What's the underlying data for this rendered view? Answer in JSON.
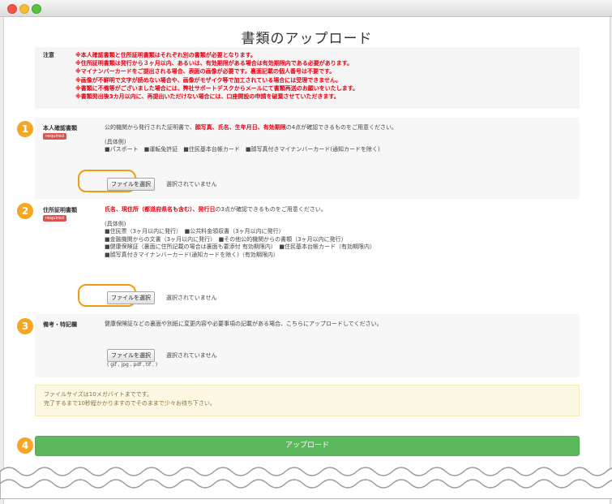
{
  "window": {
    "title": ""
  },
  "page": {
    "heading": "書類のアップロード"
  },
  "notice": {
    "label": "注意",
    "lines": [
      "※本人確認書類と住所証明書類はそれぞれ別の書類が必要となります。",
      "※住所証明書類は発行から３ヶ月以内、あるいは、有効期限がある場合は有効期限内である必要があります。",
      "※マイナンバーカードをご提出される場合、表面の画像が必要です。裏面記載の個人番号は不要です。",
      "※画像が不鮮明で文字が読めない場合や、画像がモザイク等で加工されている場合には受理できません。",
      "※書類に不備等がございました場合には、弊社サポートデスクからメールにて書類再送のお願いをいたします。",
      "※書類発出後3カ月以内に、再提出いただけない場合には、口座開設の申請を破棄させていただきます。"
    ]
  },
  "steps": [
    {
      "number": "1",
      "label": "本人確認書類",
      "required": "required",
      "desc_pre": "公的機関から発行された証明書で、",
      "desc_red": "顔写真、氏名、生年月日、有効期限",
      "desc_post": "の4点が確認できるものをご用意ください。",
      "examples": [
        "(具体例)",
        "■パスポート　■運転免許証　■住民基本台帳カード　■顔写真付きマイナンバーカード(通知カードを除く)"
      ],
      "file_button": "ファイルを選択",
      "no_file": "選択されていません"
    },
    {
      "number": "2",
      "label": "住所証明書類",
      "required": "required",
      "desc_red": "氏名、現住所（都道府県名も含む）、発行日",
      "desc_post": "の3点が確認できるものをご用意ください。",
      "examples": [
        "(具体例)",
        "■住民票（3ヶ月以内に発行）　■公共料金領収書（3ヶ月以内に発行）",
        "■金融機関からの文書（3ヶ月以内に発行）　■その他公的機関からの書類（3ヶ月以内に発行）",
        "■健康保険証（裏面に住所記載の場合は裏面も要添付 有効期限内）　■住民基本台帳カード（有効期限内）",
        "■顔写真付きマイナンバーカード(通知カードを除く)（有効期限内）"
      ],
      "file_button": "ファイルを選択",
      "no_file": "選択されていません"
    },
    {
      "number": "3",
      "label": "備考・特記欄",
      "desc": "健康保険証などの裏面や別紙に変更内容や必要事項の記載がある場合、こちらにアップロードしてください。",
      "file_button": "ファイルを選択",
      "no_file": "選択されていません",
      "formats": "( gif , jpg , pdf , tif , )"
    }
  ],
  "info": {
    "lines": [
      "ファイルサイズは10メガバイトまでです。",
      "完了するまで10秒程かかりますのでそのままで少々お待ち下さい。"
    ]
  },
  "submit": {
    "number": "4",
    "label": "アップロード"
  },
  "colors": {
    "accent": "#f5a623",
    "required": "#d9534f",
    "submit": "#5cb85c",
    "warning": "#e60012"
  }
}
